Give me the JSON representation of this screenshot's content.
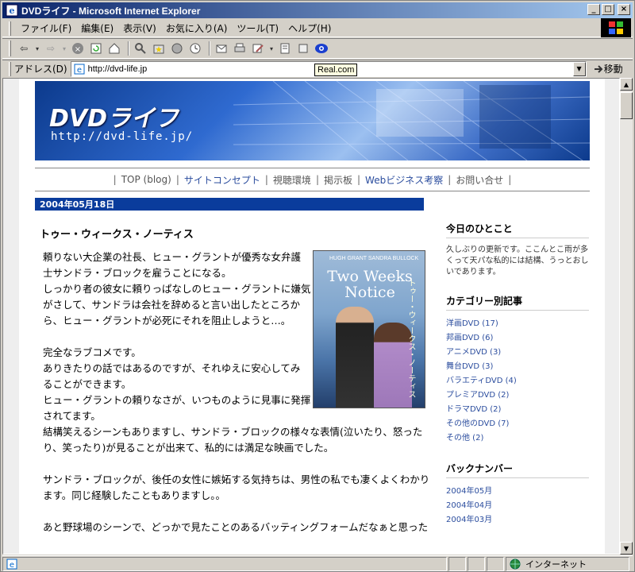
{
  "window": {
    "title": "DVDライフ - Microsoft Internet Explorer",
    "min_glyph": "_",
    "max_glyph": "□",
    "close_glyph": "×"
  },
  "menu": [
    "ファイル(F)",
    "編集(E)",
    "表示(V)",
    "お気に入り(A)",
    "ツール(T)",
    "ヘルプ(H)"
  ],
  "tooltip": "Real.com",
  "address": {
    "label": "アドレス(D)",
    "url": "http://dvd-life.jp",
    "go_label": "移動"
  },
  "status": {
    "zone": "インターネット"
  },
  "banner": {
    "logo": "DVDライフ",
    "url": "http://dvd-life.jp/"
  },
  "nav": [
    {
      "label": "TOP (blog)",
      "color": "#555555"
    },
    {
      "label": "サイトコンセプト",
      "color": "#2b4d9e"
    },
    {
      "label": "視聴環境",
      "color": "#555555"
    },
    {
      "label": "掲示板",
      "color": "#555555"
    },
    {
      "label": "Webビジネス考察",
      "color": "#2b4d9e"
    },
    {
      "label": "お問い合せ",
      "color": "#555555"
    }
  ],
  "post": {
    "date": "2004年05月18日",
    "title": "トゥー・ウィークス・ノーティス",
    "poster": {
      "names": "HUGH GRANT  SANDRA BULLOCK",
      "title": "Two Weeks Notice",
      "jp": "トゥー・ウィークス・ノーティス"
    },
    "para1": [
      "頼りない大企業の社長、ヒュー・グラントが優秀な女弁護",
      "士サンドラ・ブロックを雇うことになる。",
      "しっかり者の彼女に頼りっぱなしのヒュー・グラントに嫌気",
      "がさして、サンドラは会社を辞めると言い出したところか",
      "ら、ヒュー・グラントが必死にそれを阻止しようと…。"
    ],
    "para2": [
      "完全なラブコメです。",
      "ありきたりの話ではあるのですが、それゆえに安心してみ",
      "ることができます。",
      "ヒュー・グラントの頼りなさが、いつものように見事に発揮",
      "されてます。",
      "結構笑えるシーンもありますし、サンドラ・ブロックの様々な表情(泣いたり、怒った",
      "り、笑ったり)が見ることが出来て、私的には満足な映画でした。"
    ],
    "para3": [
      "サンドラ・ブロックが、後任の女性に嫉妬する気持ちは、男性の私でも凄くよくわかり",
      "ます。同じ経験したこともありますし。。"
    ],
    "para4": [
      "あと野球場のシーンで、どっかで見たことのあるバッティングフォームだなぁと思った"
    ]
  },
  "sidebar": {
    "today_head": "今日のひとこと",
    "today_text": "久しぶりの更新です。ここんとこ雨が多くって天パな私的には結構、うっとおしいであります。",
    "cat_head": "カテゴリー別記事",
    "categories": [
      "洋画DVD (17)",
      "邦画DVD (6)",
      "アニメDVD (3)",
      "舞台DVD (3)",
      "バラエティDVD (4)",
      "プレミアDVD (2)",
      "ドラマDVD (2)",
      "その他のDVD (7)",
      "その他 (2)"
    ],
    "backnum_head": "バックナンバー",
    "backnumbers": [
      "2004年05月",
      "2004年04月",
      "2004年03月"
    ]
  }
}
